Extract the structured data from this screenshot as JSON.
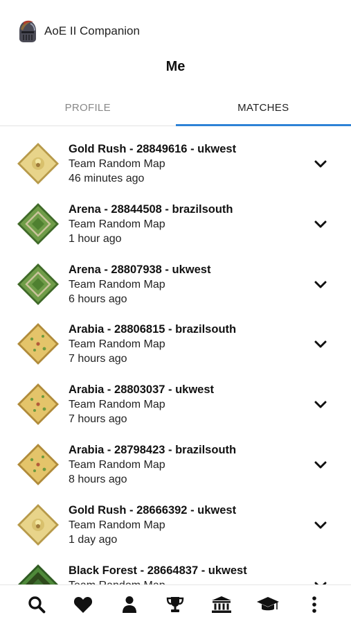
{
  "app": {
    "title": "AoE II Companion"
  },
  "page": {
    "title": "Me"
  },
  "tabs": [
    {
      "label": "PROFILE",
      "active": false
    },
    {
      "label": "MATCHES",
      "active": true
    }
  ],
  "colors": {
    "accent": "#2d82d6"
  },
  "matches": [
    {
      "title": "Gold Rush - 28849616 - ukwest",
      "mode": "Team Random Map",
      "time": "46 minutes ago",
      "map": "gold-rush"
    },
    {
      "title": "Arena - 28844508 - brazilsouth",
      "mode": "Team Random Map",
      "time": "1 hour ago",
      "map": "arena"
    },
    {
      "title": "Arena - 28807938 - ukwest",
      "mode": "Team Random Map",
      "time": "6 hours ago",
      "map": "arena"
    },
    {
      "title": "Arabia - 28806815 - brazilsouth",
      "mode": "Team Random Map",
      "time": "7 hours ago",
      "map": "arabia"
    },
    {
      "title": "Arabia - 28803037 - ukwest",
      "mode": "Team Random Map",
      "time": "7 hours ago",
      "map": "arabia"
    },
    {
      "title": "Arabia - 28798423 - brazilsouth",
      "mode": "Team Random Map",
      "time": "8 hours ago",
      "map": "arabia"
    },
    {
      "title": "Gold Rush - 28666392 - ukwest",
      "mode": "Team Random Map",
      "time": "1 day ago",
      "map": "gold-rush"
    },
    {
      "title": "Black Forest - 28664837 - ukwest",
      "mode": "Team Random Map",
      "time": "",
      "map": "black-forest"
    }
  ],
  "nav": [
    {
      "name": "search-icon"
    },
    {
      "name": "heart-icon"
    },
    {
      "name": "person-icon"
    },
    {
      "name": "trophy-icon"
    },
    {
      "name": "bank-icon"
    },
    {
      "name": "graduation-cap-icon"
    },
    {
      "name": "more-vertical-icon"
    }
  ]
}
